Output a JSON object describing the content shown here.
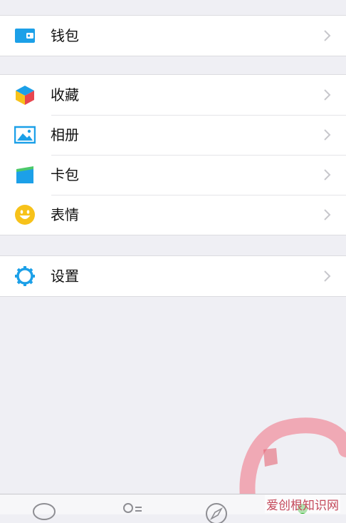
{
  "groups": [
    {
      "items": [
        {
          "label": "钱包",
          "icon": "wallet-icon"
        }
      ]
    },
    {
      "items": [
        {
          "label": "收藏",
          "icon": "favorites-cube-icon"
        },
        {
          "label": "相册",
          "icon": "album-photo-icon"
        },
        {
          "label": "卡包",
          "icon": "card-pack-icon"
        },
        {
          "label": "表情",
          "icon": "smiley-icon"
        }
      ]
    },
    {
      "items": [
        {
          "label": "设置",
          "icon": "settings-gear-icon"
        }
      ]
    }
  ],
  "tabbar": {
    "tabs": [
      {
        "icon": "chats-bubble-icon"
      },
      {
        "icon": "contacts-icon"
      },
      {
        "icon": "discover-compass-icon"
      },
      {
        "icon": "me-icon"
      }
    ]
  },
  "watermark": "爱创根知识网",
  "colors": {
    "background": "#efeff4",
    "accent_blue": "#1ca0e8",
    "smiley_yellow": "#f7c21a",
    "active_green": "#1aad19"
  }
}
